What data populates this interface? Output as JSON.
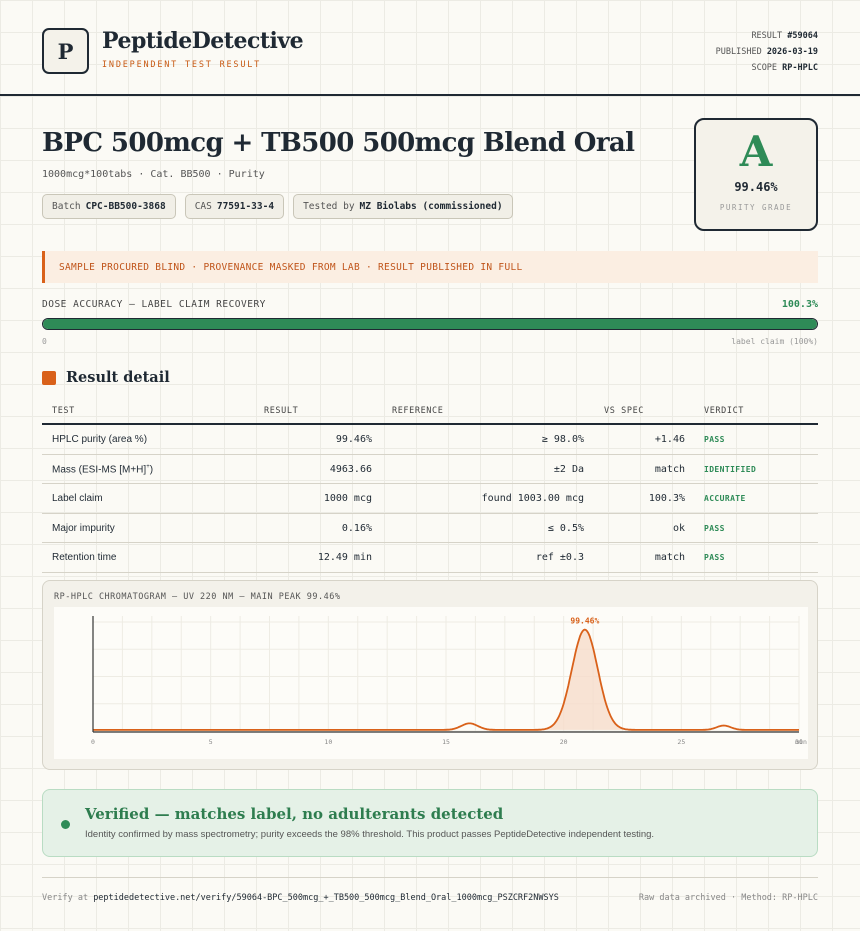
{
  "header": {
    "logo_letter": "P",
    "brand": "PeptideDetective",
    "subtitle": "INDEPENDENT TEST RESULT",
    "meta": {
      "result_label": "RESULT",
      "result_value": "#59064",
      "published_label": "PUBLISHED",
      "published_value": "2026-03-19",
      "scope_label": "SCOPE",
      "scope_value": "RP-HPLC"
    }
  },
  "product": {
    "title": "BPC 500mcg + TB500 500mcg Blend Oral",
    "subtitle": "1000mcg*100tabs · Cat. BB500 · Purity",
    "chips": {
      "batch_label": "Batch",
      "batch_value": "CPC-BB500-3868",
      "cas_label": "CAS",
      "cas_value": "77591-33-4",
      "tested_label": "Tested by",
      "tested_value": "MZ Biolabs (commissioned)"
    }
  },
  "grade": {
    "letter": "A",
    "percent": "99.46%",
    "label": "PURITY GRADE"
  },
  "notice": "SAMPLE PROCURED BLIND · PROVENANCE MASKED FROM LAB · RESULT PUBLISHED IN FULL",
  "dose": {
    "label": "DOSE ACCURACY — LABEL CLAIM RECOVERY",
    "value": "100.3%",
    "fill_fraction": 1.0,
    "min_label": "0",
    "claim_label": "label claim (100%)"
  },
  "results": {
    "section_title": "Result detail",
    "headers": {
      "test": "TEST",
      "result": "RESULT",
      "reference": "REFERENCE",
      "vs_spec": "VS SPEC",
      "verdict": "VERDICT"
    },
    "rows": [
      {
        "test": "HPLC purity (area %)",
        "result": "99.46%",
        "reference": "≥ 98.0%",
        "vs_spec": "+1.46",
        "verdict": "PASS"
      },
      {
        "test": "Mass (ESI-MS [M+H]",
        "test_sup": "+",
        "test_end": ")",
        "result": "4963.66",
        "reference": "±2 Da",
        "vs_spec": "match",
        "verdict": "IDENTIFIED"
      },
      {
        "test": "Label claim",
        "result": "1000 mcg",
        "reference": "found 1003.00 mcg",
        "vs_spec": "100.3%",
        "verdict": "ACCURATE"
      },
      {
        "test": "Major impurity",
        "result": "0.16%",
        "reference": "≤ 0.5%",
        "vs_spec": "ok",
        "verdict": "PASS"
      },
      {
        "test": "Retention time",
        "result": "12.49 min",
        "reference": "ref ±0.3",
        "vs_spec": "match",
        "verdict": "PASS"
      }
    ]
  },
  "chart_data": {
    "type": "line",
    "title": "RP-HPLC CHROMATOGRAM — UV 220 NM — MAIN PEAK 99.46%",
    "xlabel": "",
    "ylabel": "",
    "xlim": [
      0,
      30
    ],
    "ylim": [
      0,
      100
    ],
    "x_ticks": [
      "0",
      "5",
      "10",
      "15",
      "20",
      "25",
      "30"
    ],
    "x_unit": "min",
    "baseline": 1,
    "peaks": [
      {
        "x": 16.0,
        "height": 6,
        "width": 0.35
      },
      {
        "x": 20.9,
        "height": 92,
        "width": 0.55
      },
      {
        "x": 26.8,
        "height": 4,
        "width": 0.3
      }
    ],
    "peak_label": "99.46%",
    "grid": true
  },
  "verified": {
    "title": "Verified — matches label, no adulterants detected",
    "text": "Identity confirmed by mass spectrometry; purity exceeds the 98% threshold. This product passes PeptideDetective independent testing."
  },
  "footer": {
    "verify_label": "Verify at",
    "verify_url": "peptidedetective.net/verify/59064-BPC_500mcg_+_TB500_500mcg_Blend_Oral_1000mcg_PSZCRF2NWSYS",
    "right": "Raw data archived · Method: RP-HPLC"
  },
  "colors": {
    "accent": "#d9611a",
    "pass": "#2e8b57",
    "ink": "#1f2933"
  }
}
